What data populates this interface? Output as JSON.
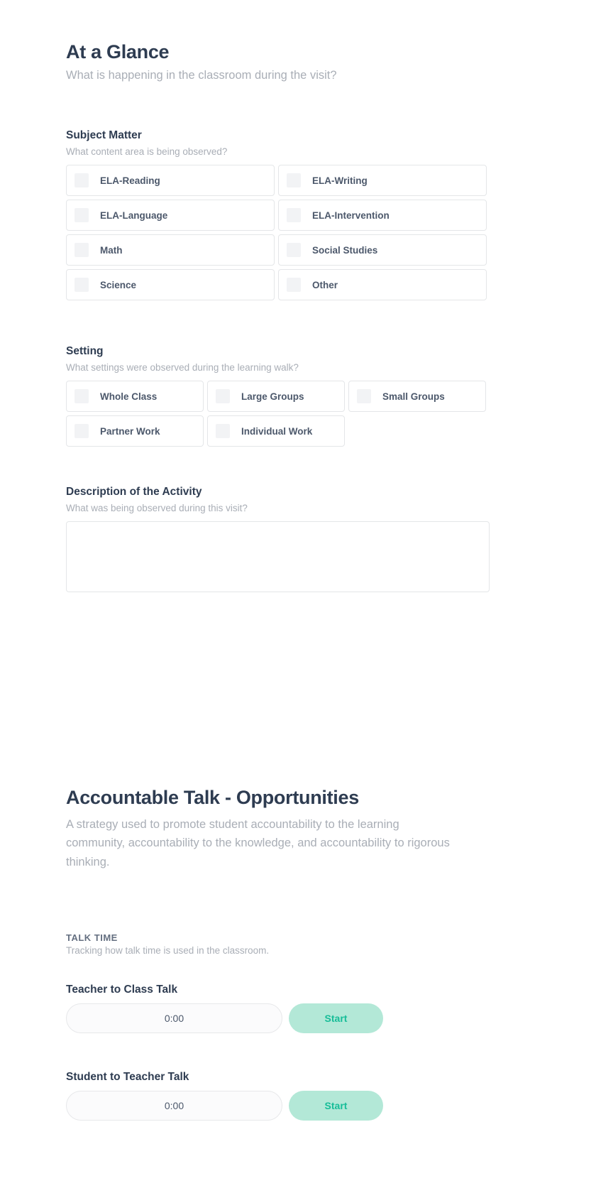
{
  "at_a_glance": {
    "title": "At a Glance",
    "subtitle": "What is happening in the classroom during the visit?",
    "subject_matter": {
      "title": "Subject Matter",
      "subtitle": "What content area is being observed?",
      "options": [
        {
          "label": "ELA-Reading",
          "checked": false
        },
        {
          "label": "ELA-Writing",
          "checked": false
        },
        {
          "label": "ELA-Language",
          "checked": false
        },
        {
          "label": "ELA-Intervention",
          "checked": false
        },
        {
          "label": "Math",
          "checked": false
        },
        {
          "label": "Social Studies",
          "checked": false
        },
        {
          "label": "Science",
          "checked": false
        },
        {
          "label": "Other",
          "checked": false
        }
      ]
    },
    "setting": {
      "title": "Setting",
      "subtitle": "What settings were observed during the learning walk?",
      "options": [
        {
          "label": "Whole Class",
          "checked": false
        },
        {
          "label": "Large Groups",
          "checked": false
        },
        {
          "label": "Small Groups",
          "checked": false
        },
        {
          "label": "Partner Work",
          "checked": false
        },
        {
          "label": "Individual Work",
          "checked": false
        }
      ]
    },
    "description": {
      "title": "Description of the Activity",
      "subtitle": "What was being observed during this visit?",
      "value": "",
      "placeholder": ""
    }
  },
  "accountable_talk": {
    "title": "Accountable Talk - Opportunities",
    "description": "A strategy used to promote student accountability to the learning community, accountability to the knowledge, and accountability to rigorous thinking.",
    "talk_time": {
      "label": "TALK TIME",
      "subtitle": "Tracking how talk time is used in the classroom.",
      "timers": [
        {
          "title": "Teacher to Class Talk",
          "value": "0:00",
          "button": "Start"
        },
        {
          "title": "Student to Teacher Talk",
          "value": "0:00",
          "button": "Start"
        }
      ]
    }
  },
  "colors": {
    "heading": "#2e3c51",
    "muted": "#a9aeb6",
    "card_border": "#e4e6e8",
    "checkbox_fill": "#f2f3f5",
    "accent_bg": "#b3e8d7",
    "accent_text": "#17bd98"
  }
}
